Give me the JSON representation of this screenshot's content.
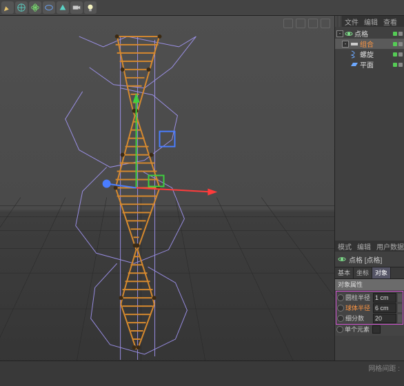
{
  "menus": {
    "file": "文件",
    "edit": "编辑",
    "view": "查看"
  },
  "toolbar": {
    "b1": "pen-icon",
    "b2": "globe-icon",
    "b3": "atom-icon",
    "b4": "ellipse-icon",
    "b5": "cube-icon",
    "b6": "camera-icon",
    "b7": "light-icon"
  },
  "tree": {
    "root": "点格",
    "zuhe": "组合",
    "child1": "螺旋",
    "child2": "平面"
  },
  "attr_menus": {
    "mode": "模式",
    "edit": "编辑",
    "user": "用户数据"
  },
  "attr_header": {
    "obj_label": "点格 [点格]"
  },
  "tabs": {
    "basic": "基本",
    "coord": "坐标",
    "object": "对象"
  },
  "attr_title": "对象属性",
  "props": {
    "cyl_label": "圆柱半径",
    "cyl_value": "1 cm",
    "sph_label": "球体半径",
    "sph_value": "6 cm",
    "seg_label": "细分数",
    "seg_value": "20",
    "single_label": "单个元素"
  },
  "footer": {
    "hint": "网格间距 :"
  }
}
